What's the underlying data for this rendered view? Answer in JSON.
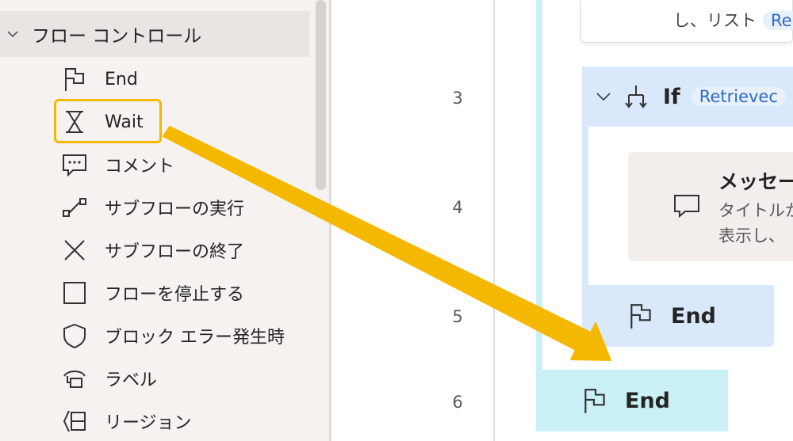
{
  "panel": {
    "group_label": "フロー コントロール",
    "items": [
      {
        "label": "End",
        "icon": "flag-icon"
      },
      {
        "label": "Wait",
        "icon": "hourglass-icon"
      },
      {
        "label": "コメント",
        "icon": "comment-icon"
      },
      {
        "label": "サブフローの実行",
        "icon": "subflow-run-icon"
      },
      {
        "label": "サブフローの終了",
        "icon": "close-icon"
      },
      {
        "label": "フローを停止する",
        "icon": "stop-square-icon"
      },
      {
        "label": "ブロック エラー発生時",
        "icon": "shield-icon"
      },
      {
        "label": "ラベル",
        "icon": "label-icon"
      },
      {
        "label": "リージョン",
        "icon": "region-icon"
      }
    ],
    "highlighted_item": "Wait"
  },
  "flow": {
    "line_numbers": [
      "3",
      "4",
      "5",
      "6"
    ],
    "prev_action": {
      "text": "し、リスト",
      "chip": "Re"
    },
    "if_block": {
      "keyword": "If",
      "chip": "Retrievec"
    },
    "message_action": {
      "title": "メッセー",
      "desc_line1": "タイトルか",
      "desc_line2": "表示し、"
    },
    "inner_end": {
      "keyword": "End"
    },
    "outer_end": {
      "keyword": "End"
    }
  },
  "colors": {
    "highlight": "#f5b800",
    "arrow": "#f5b800",
    "if_block_bg": "#dae8fb",
    "outer_block_bg": "#c9f1f5",
    "chip_text": "#2f6bc2"
  }
}
